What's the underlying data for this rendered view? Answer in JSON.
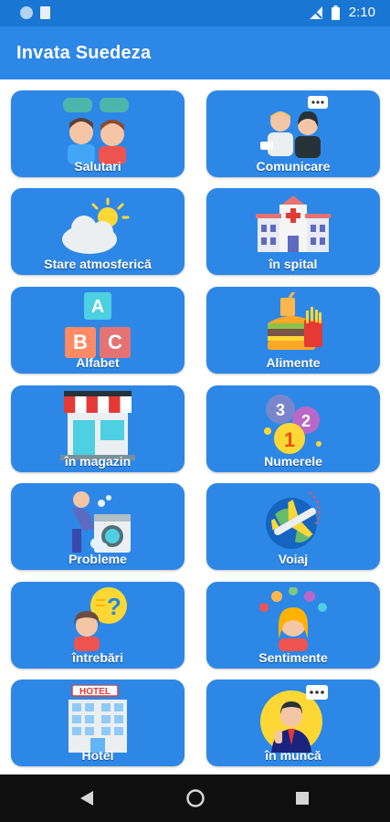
{
  "status_bar": {
    "time": "2:10",
    "icons": [
      "notification-dot-icon",
      "sd-card-icon",
      "no-signal-icon",
      "battery-icon"
    ]
  },
  "app_bar": {
    "title": "Invata Suedeza"
  },
  "categories": [
    {
      "label": "Salutari",
      "icon": "greeting-people-icon"
    },
    {
      "label": "Comunicare",
      "icon": "communication-icon"
    },
    {
      "label": "Stare atmosferică",
      "icon": "weather-icon"
    },
    {
      "label": "în spital",
      "icon": "hospital-icon"
    },
    {
      "label": "Alfabet",
      "icon": "abc-blocks-icon"
    },
    {
      "label": "Alimente",
      "icon": "food-icon"
    },
    {
      "label": "în magazin",
      "icon": "shop-icon"
    },
    {
      "label": "Numerele",
      "icon": "numbers-balloons-icon"
    },
    {
      "label": "Probleme",
      "icon": "laundry-problem-icon"
    },
    {
      "label": "Voiaj",
      "icon": "travel-plane-icon"
    },
    {
      "label": "întrebări",
      "icon": "question-girl-icon"
    },
    {
      "label": "Sentimente",
      "icon": "feelings-balloons-icon"
    },
    {
      "label": "Hotel",
      "icon": "hotel-building-icon"
    },
    {
      "label": "în muncă",
      "icon": "work-man-icon"
    }
  ],
  "hotel_sign": "HOTEL",
  "abc": [
    "A",
    "B",
    "C"
  ],
  "numbers": [
    "3",
    "2",
    "1"
  ],
  "colors": {
    "primary": "#2d87e6",
    "status": "#1976d2",
    "nav": "#0f0f0f"
  }
}
